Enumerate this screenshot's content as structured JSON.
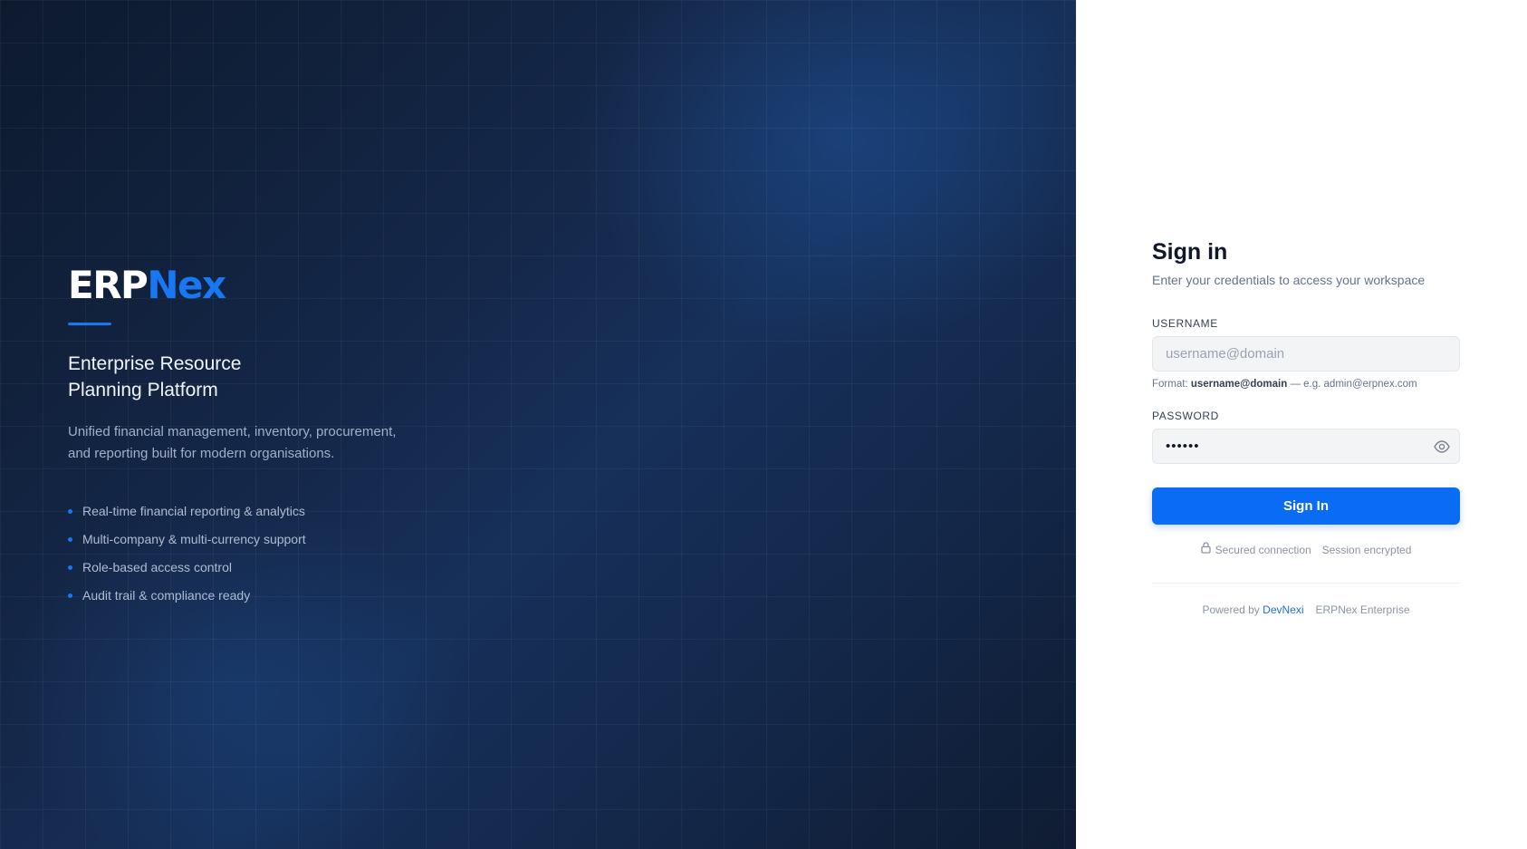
{
  "brand": {
    "logo_part1": "ERP",
    "logo_part2": "Nex",
    "tagline": "Enterprise Resource Planning Platform",
    "description": "Unified financial management, inventory, procurement, and reporting built for modern organisations.",
    "features": [
      "Real-time financial reporting & analytics",
      "Multi-company & multi-currency support",
      "Role-based access control",
      "Audit trail & compliance ready"
    ],
    "accent_color": "#1877f2"
  },
  "signin": {
    "title": "Sign in",
    "subtitle": "Enter your credentials to access your workspace",
    "username_label": "USERNAME",
    "username_placeholder": "username@domain",
    "username_value": "",
    "format_prefix": "Format:",
    "format_value": "username@domain",
    "format_example": "— e.g. admin@erpnex.com",
    "password_label": "PASSWORD",
    "password_value": "••••••",
    "password_toggle_icon": "eye-icon",
    "submit_label": "Sign In",
    "button_color": "#0a6cf5",
    "security_secured": "Secured connection",
    "security_encrypted": "Session encrypted",
    "security_icon": "lock-icon"
  },
  "footer": {
    "powered_prefix": "Powered by",
    "powered_link": "DevNexi",
    "edition": "ERPNex Enterprise"
  }
}
